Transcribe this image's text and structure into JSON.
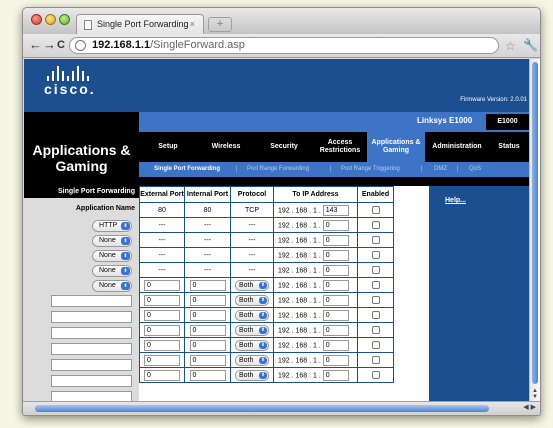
{
  "browser": {
    "tab_title": "Single Port Forwarding",
    "tab_close": "×",
    "new_tab": "+",
    "back": "←",
    "forward": "→",
    "reload": "C",
    "url_host": "192.168.1.1",
    "url_path": "/SingleForward.asp",
    "star": "☆",
    "wrench": "🔧"
  },
  "header": {
    "logo_text": "cisco.",
    "firmware": "Firmware Version: 2.0.01",
    "model_name": "Linksys E1000",
    "model_box": "E1000",
    "section_title": "Applications & Gaming"
  },
  "main_nav": [
    {
      "label": "Setup"
    },
    {
      "label": "Wireless"
    },
    {
      "label": "Security"
    },
    {
      "label": "Access Restrictions"
    },
    {
      "label": "Applications & Gaming"
    },
    {
      "label": "Administration"
    },
    {
      "label": "Status"
    }
  ],
  "sub_nav": [
    {
      "label": "Single Port Forwarding"
    },
    {
      "label": "Port Range Forwarding"
    },
    {
      "label": "Port Range Triggering"
    },
    {
      "label": "DMZ"
    },
    {
      "label": "QoS"
    }
  ],
  "sub_nav_sep": "|",
  "left_panel": {
    "heading": "Single Port Forwarding",
    "app_name_label": "Application Name",
    "app_selects": [
      "HTTP",
      "None",
      "None",
      "None",
      "None"
    ],
    "select_arrow": "⬍"
  },
  "table": {
    "headers": [
      "External Port",
      "Internal Port",
      "Protocol",
      "To IP Address",
      "Enabled"
    ],
    "ip_prefix": "192 . 168 . 1 .",
    "fixed_rows": [
      {
        "external": "80",
        "internal": "80",
        "protocol": "TCP",
        "ip_last": "143"
      },
      {
        "external": "---",
        "internal": "---",
        "protocol": "---",
        "ip_last": "0"
      },
      {
        "external": "---",
        "internal": "---",
        "protocol": "---",
        "ip_last": "0"
      },
      {
        "external": "---",
        "internal": "---",
        "protocol": "---",
        "ip_last": "0"
      },
      {
        "external": "---",
        "internal": "---",
        "protocol": "---",
        "ip_last": "0"
      }
    ],
    "custom_rows": [
      {
        "external": "0",
        "internal": "0",
        "protocol": "Both",
        "ip_last": "0"
      },
      {
        "external": "0",
        "internal": "0",
        "protocol": "Both",
        "ip_last": "0"
      },
      {
        "external": "0",
        "internal": "0",
        "protocol": "Both",
        "ip_last": "0"
      },
      {
        "external": "0",
        "internal": "0",
        "protocol": "Both",
        "ip_last": "0"
      },
      {
        "external": "0",
        "internal": "0",
        "protocol": "Both",
        "ip_last": "0"
      },
      {
        "external": "0",
        "internal": "0",
        "protocol": "Both",
        "ip_last": "0"
      },
      {
        "external": "0",
        "internal": "0",
        "protocol": "Both",
        "ip_last": "0"
      }
    ]
  },
  "right_panel": {
    "help_link": "Help..."
  },
  "colors": {
    "brand_blue": "#1c4f8f",
    "nav_blue": "#3d74c5"
  }
}
